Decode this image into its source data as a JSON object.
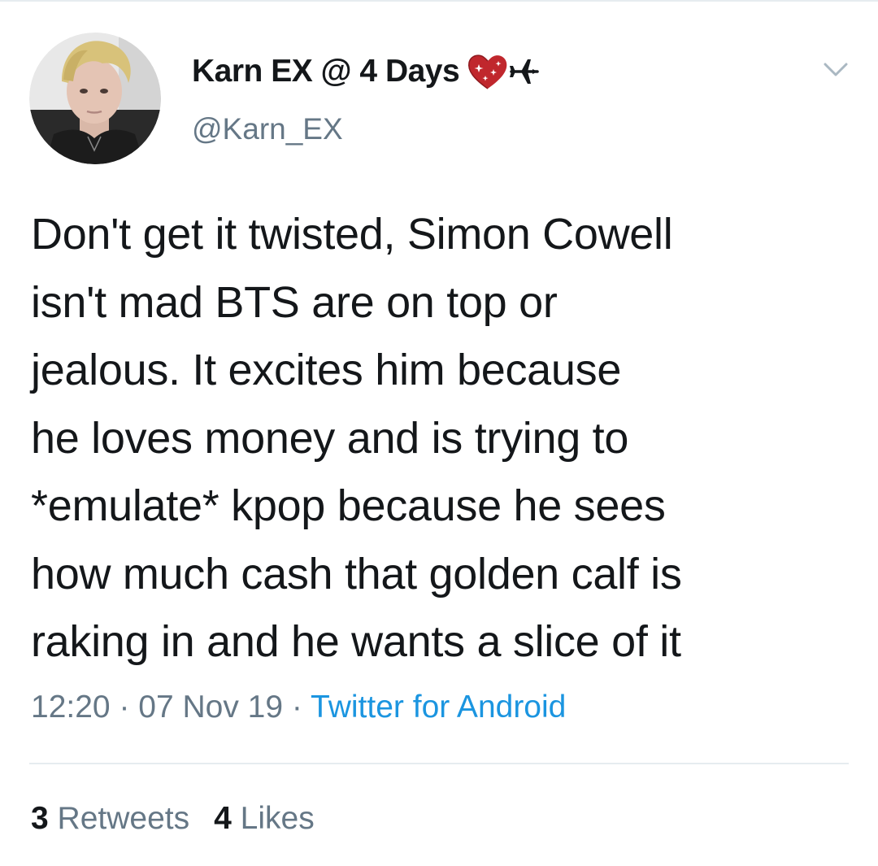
{
  "tweet": {
    "author": {
      "display_name": "Karn EX @ 4 Days",
      "handle": "@Karn_EX",
      "avatar_icon": "profile-photo",
      "name_emoji": [
        "sparkling-heart-icon",
        "airplane-icon"
      ]
    },
    "text": "Don't get it twisted, Simon Cowell\nisn't mad BTS are on top or\njealous. It excites him because\nhe loves money and is trying to\n*emulate* kpop because he sees\nhow much cash that golden calf is\nraking in and he wants a slice of it",
    "meta": {
      "time": "12:20",
      "separator": " · ",
      "date": "07 Nov 19",
      "source": "Twitter for Android"
    },
    "stats": {
      "retweets_count": "3",
      "retweets_label": "Retweets",
      "likes_count": "4",
      "likes_label": "Likes"
    }
  },
  "colors": {
    "text_primary": "#14171a",
    "text_secondary": "#657786",
    "link": "#1b95e0",
    "divider": "#e6ecf0"
  }
}
